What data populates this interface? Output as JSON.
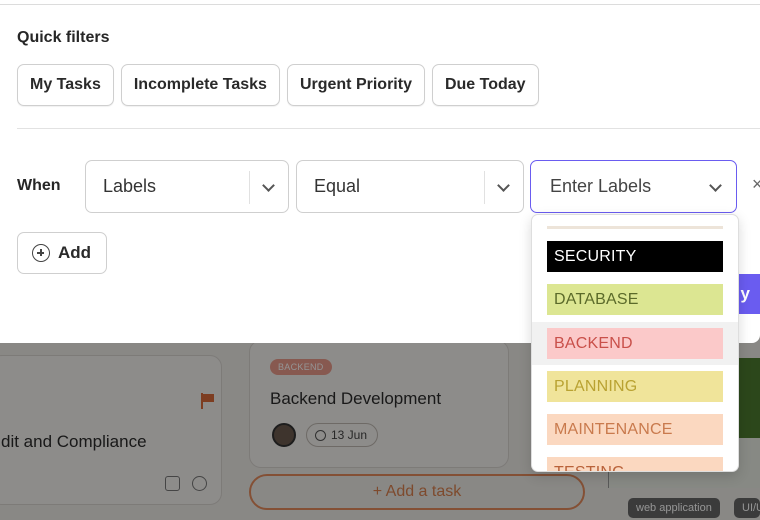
{
  "background": {
    "card_left": {
      "title": "dit and Compliance"
    },
    "card_mid": {
      "badge": "BACKEND",
      "title": "Backend Development",
      "date": "13 Jun"
    },
    "add_task_label": "+ Add a task",
    "tags": [
      "web application",
      "UI/U"
    ]
  },
  "filters": {
    "quick_filters_label": "Quick filters",
    "chips": [
      "My Tasks",
      "Incomplete Tasks",
      "Urgent Priority",
      "Due Today"
    ],
    "condition": {
      "when_label": "When",
      "field": "Labels",
      "operator": "Equal",
      "value_placeholder": "Enter Labels"
    },
    "add_label": "Add",
    "apply_label": "y",
    "close_symbol": "×"
  },
  "label_options": [
    {
      "name": "SECURITY",
      "bg": "#000000",
      "fg": "#ffffff"
    },
    {
      "name": "DATABASE",
      "bg": "#dce692",
      "fg": "#5b6a2a"
    },
    {
      "name": "BACKEND",
      "bg": "#fbc9c9",
      "fg": "#c9504a"
    },
    {
      "name": "PLANNING",
      "bg": "#f0e49a",
      "fg": "#b9a232"
    },
    {
      "name": "MAINTENANCE",
      "bg": "#fbd8c0",
      "fg": "#c97a4d"
    },
    {
      "name": "TESTING",
      "bg": "#fbd8c0",
      "fg": "#b9623a"
    }
  ],
  "colors": {
    "accent": "#6a5cf0",
    "add_task_accent": "#e38b5c"
  }
}
